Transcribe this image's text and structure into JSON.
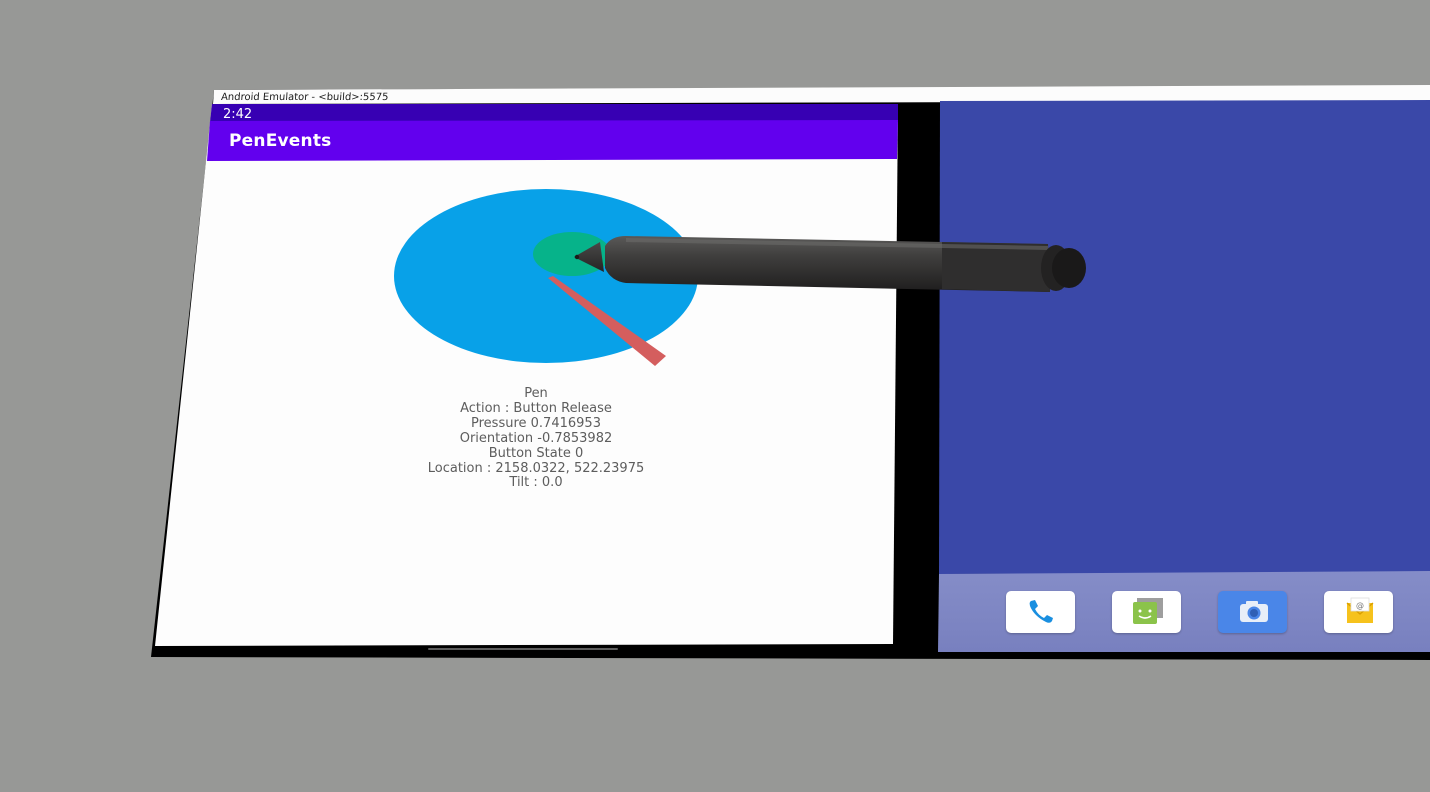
{
  "window": {
    "title": "Android Emulator - <build>:5575"
  },
  "status_bar": {
    "time": "2:42"
  },
  "app_bar": {
    "title": "PenEvents"
  },
  "pen_info": {
    "tool": "Pen",
    "action": "Action : Button Release",
    "pressure": "Pressure 0.7416953",
    "orientation": "Orientation -0.7853982",
    "button_state": "Button State 0",
    "location": "Location : 2158.0322, 522.23975",
    "tilt": "Tilt : 0.0"
  },
  "dock": {
    "apps": [
      {
        "name": "phone-icon",
        "color": "#ffffff"
      },
      {
        "name": "messages-icon",
        "color": "#ffffff"
      },
      {
        "name": "camera-icon",
        "color": "#4a86e8"
      },
      {
        "name": "email-icon",
        "color": "#ffffff"
      }
    ]
  },
  "colors": {
    "app_bar": "#6200ee",
    "status_bar": "#3700b3",
    "pressure_circle": "#08a1e8",
    "contact_circle": "#06b38a",
    "orientation_needle": "#d45e5e",
    "home_wallpaper": "#3a48a8",
    "dock_background": "#7f88c6"
  }
}
